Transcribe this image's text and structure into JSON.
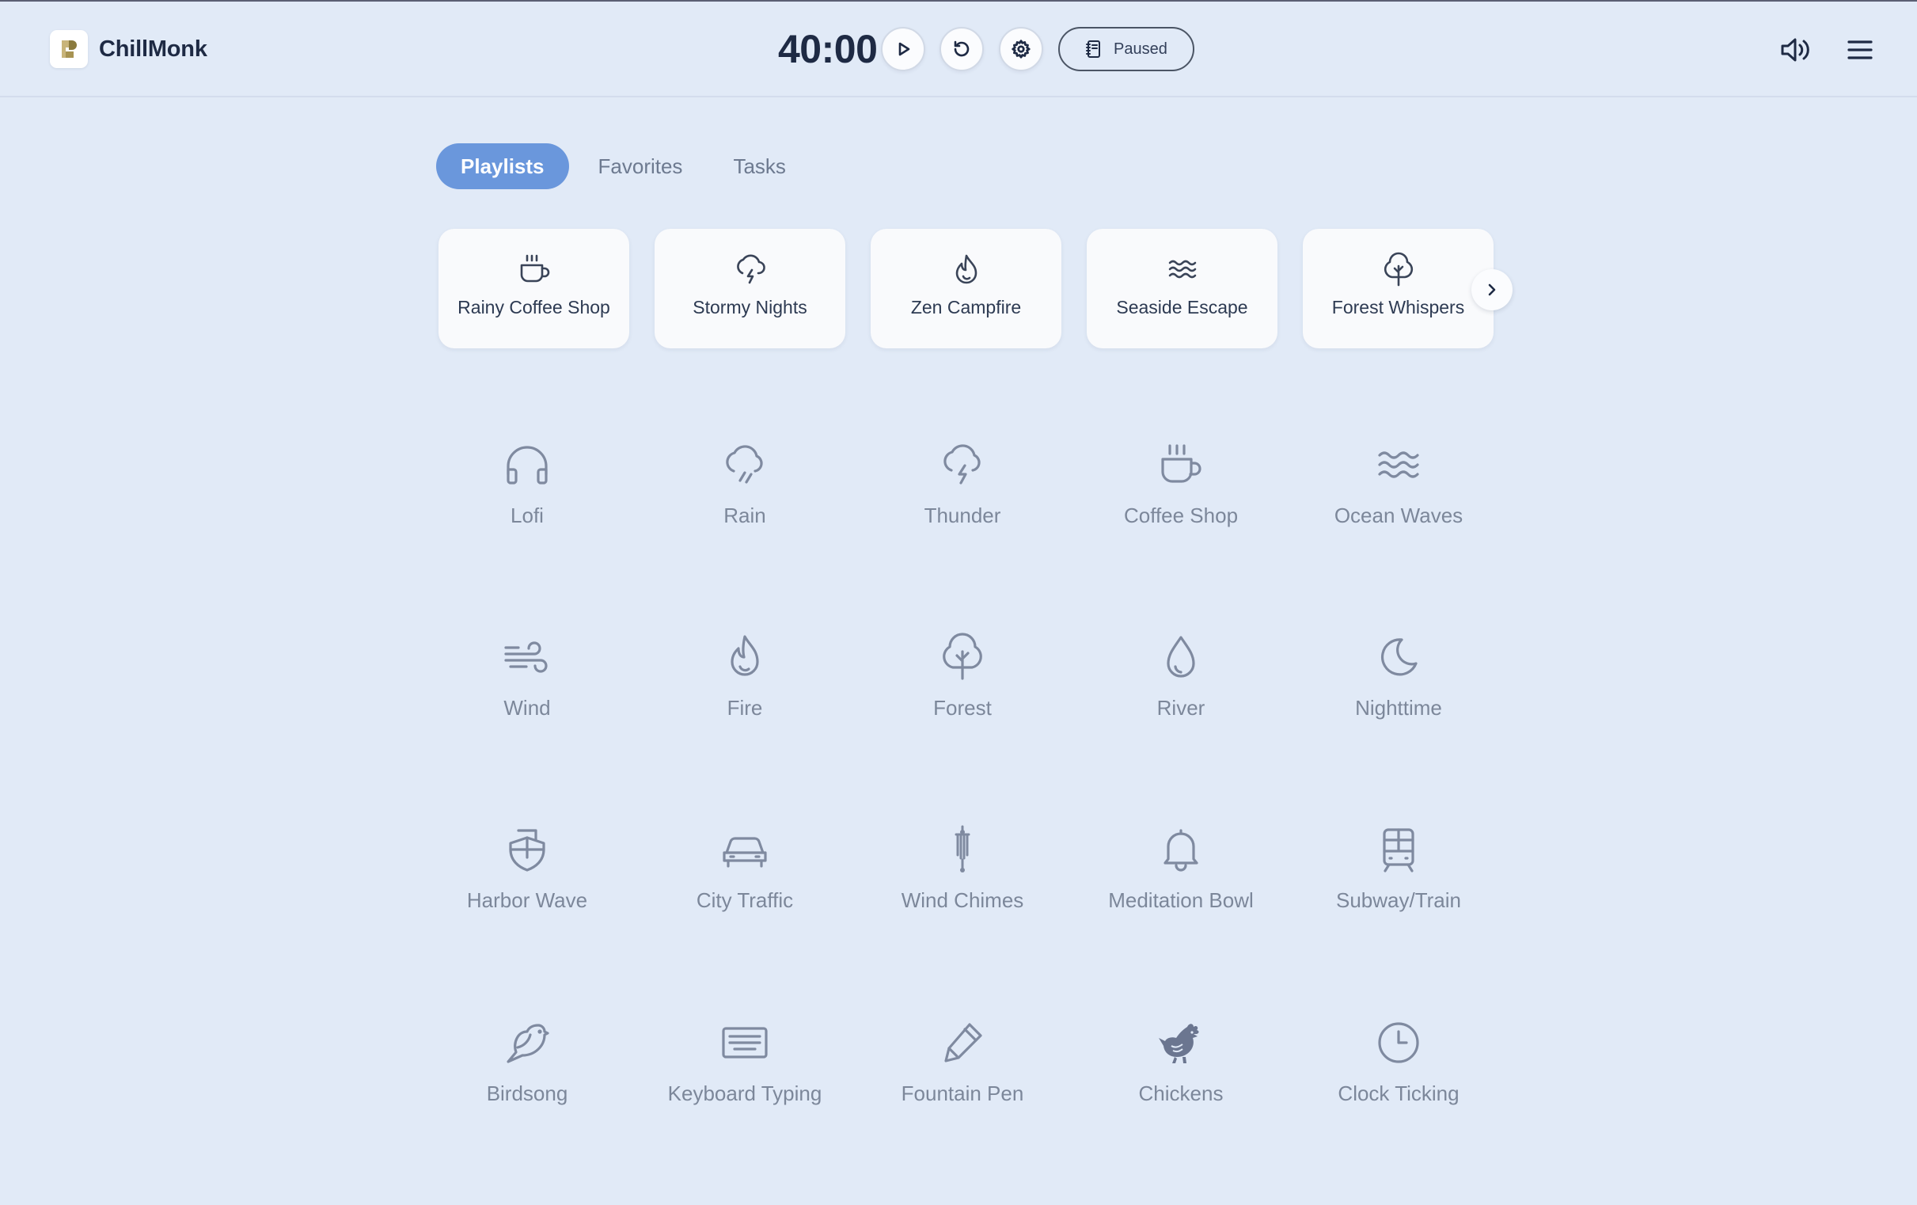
{
  "app": {
    "name": "ChillMonk"
  },
  "timer": {
    "display": "40:00",
    "status": "Paused"
  },
  "colors": {
    "background": "#e1eaf7",
    "accent": "#6a97dc",
    "icon": "#7f8aa0",
    "text_dark": "#1e2a44"
  },
  "header": {
    "icons": [
      "play-icon",
      "reset-icon",
      "settings-icon",
      "notebook-icon",
      "volume-icon",
      "menu-icon"
    ]
  },
  "tabs": [
    {
      "label": "Playlists",
      "active": true
    },
    {
      "label": "Favorites",
      "active": false
    },
    {
      "label": "Tasks",
      "active": false
    }
  ],
  "playlists": [
    {
      "label": "Rainy Coffee Shop",
      "icon": "coffee-icon"
    },
    {
      "label": "Stormy Nights",
      "icon": "storm-icon"
    },
    {
      "label": "Zen Campfire",
      "icon": "flame-icon"
    },
    {
      "label": "Seaside Escape",
      "icon": "waves-icon"
    },
    {
      "label": "Forest Whispers",
      "icon": "tree-icon"
    }
  ],
  "sounds": [
    {
      "label": "Lofi",
      "icon": "headphones-icon"
    },
    {
      "label": "Rain",
      "icon": "rain-icon"
    },
    {
      "label": "Thunder",
      "icon": "thunder-icon"
    },
    {
      "label": "Coffee Shop",
      "icon": "coffee-icon"
    },
    {
      "label": "Ocean Waves",
      "icon": "waves-icon"
    },
    {
      "label": "Wind",
      "icon": "wind-icon"
    },
    {
      "label": "Fire",
      "icon": "flame-icon"
    },
    {
      "label": "Forest",
      "icon": "tree-icon"
    },
    {
      "label": "River",
      "icon": "droplet-icon"
    },
    {
      "label": "Nighttime",
      "icon": "moon-icon"
    },
    {
      "label": "Harbor Wave",
      "icon": "boat-icon"
    },
    {
      "label": "City Traffic",
      "icon": "car-icon"
    },
    {
      "label": "Wind Chimes",
      "icon": "wind-chimes-icon"
    },
    {
      "label": "Meditation Bowl",
      "icon": "bell-icon"
    },
    {
      "label": "Subway/Train",
      "icon": "train-icon"
    },
    {
      "label": "Birdsong",
      "icon": "bird-icon"
    },
    {
      "label": "Keyboard Typing",
      "icon": "keyboard-icon"
    },
    {
      "label": "Fountain Pen",
      "icon": "pen-icon"
    },
    {
      "label": "Chickens",
      "icon": "chicken-icon"
    },
    {
      "label": "Clock Ticking",
      "icon": "clock-icon"
    }
  ]
}
